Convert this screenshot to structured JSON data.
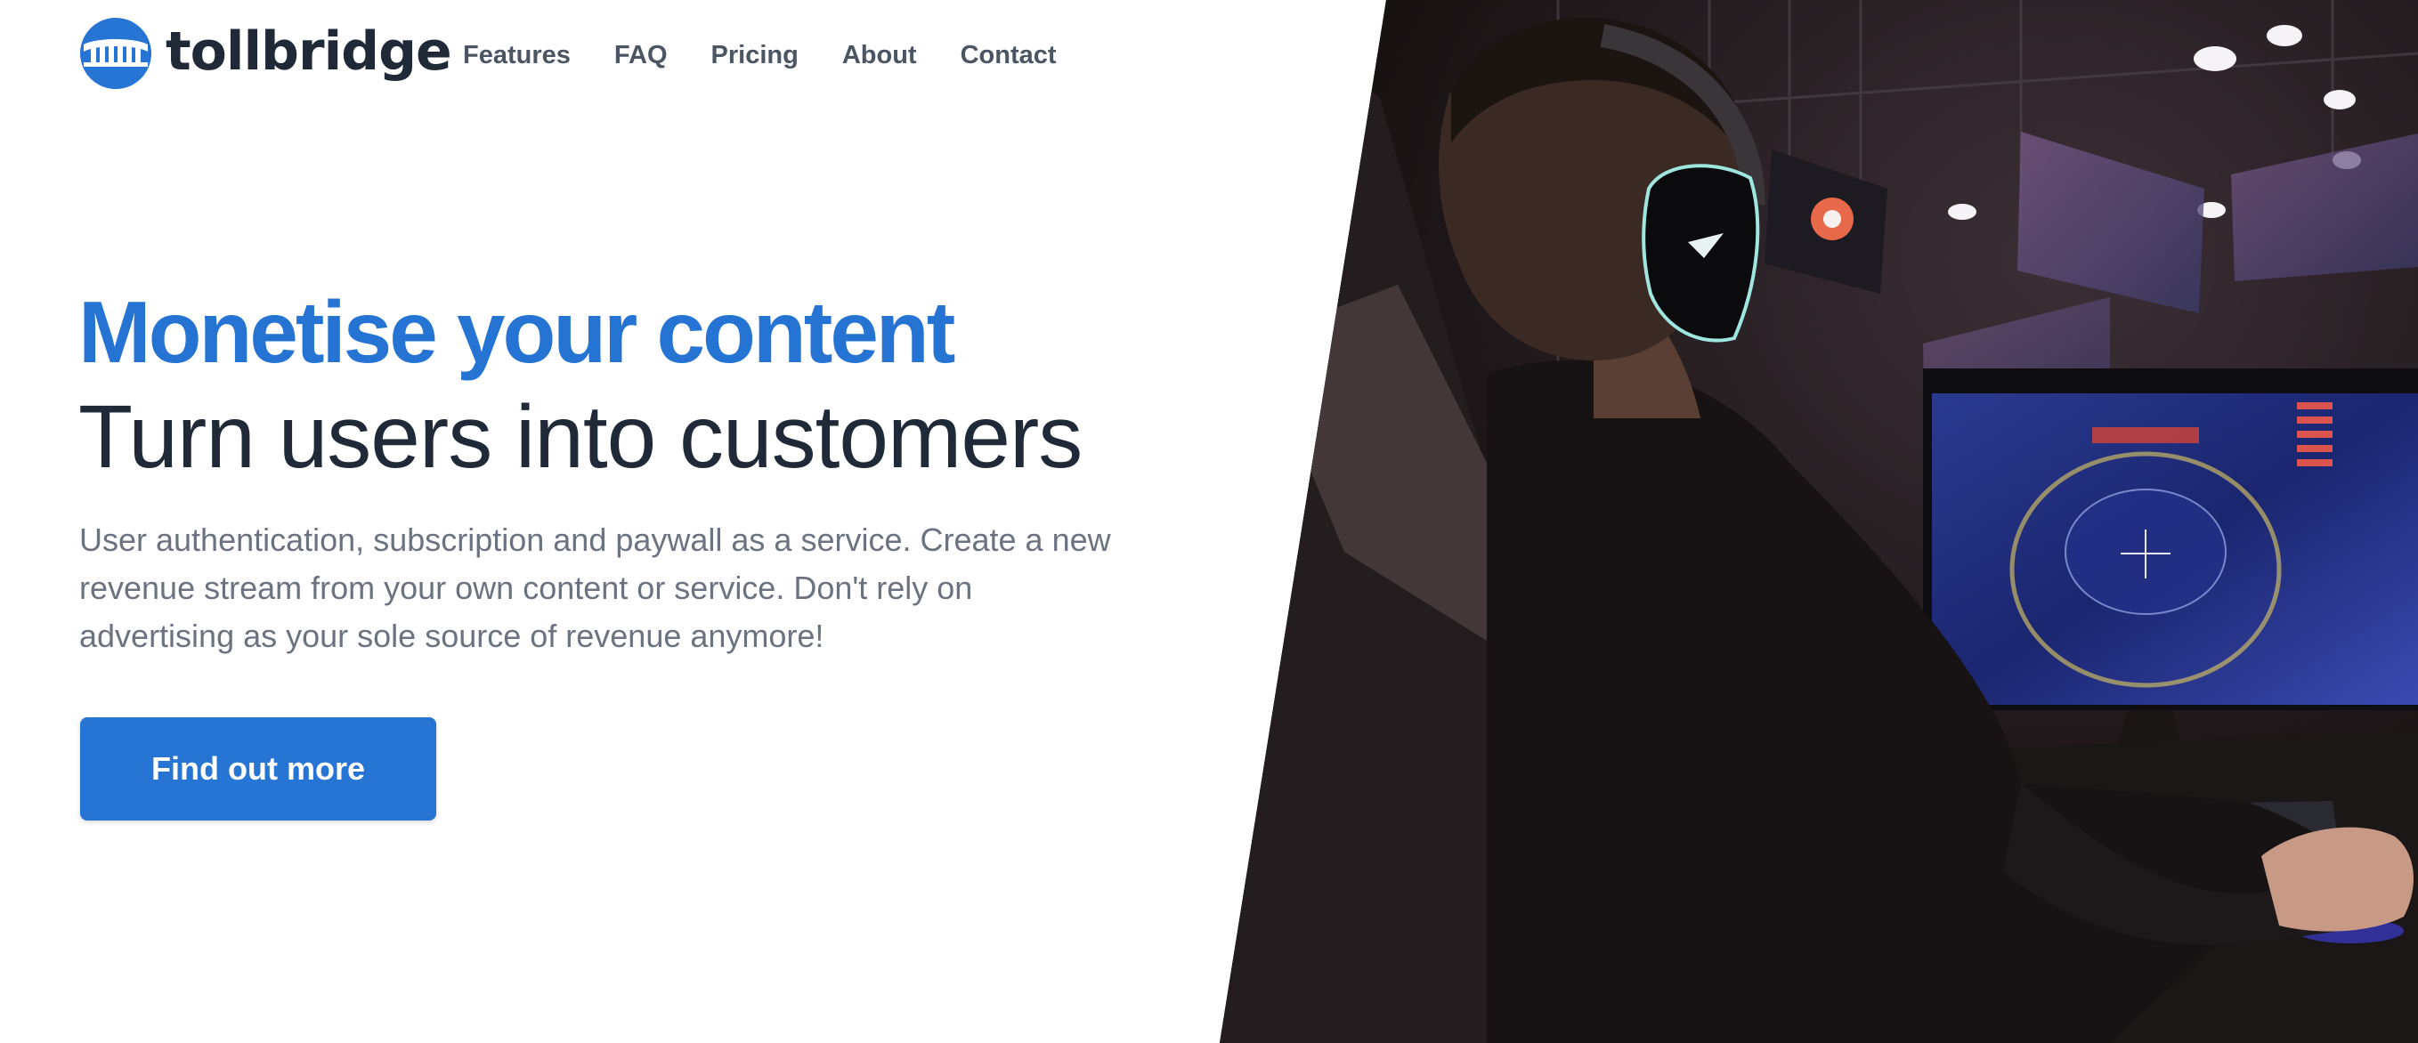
{
  "brand": {
    "name": "tollbridge",
    "logo_icon": "bridge-logo-icon",
    "primary_color": "#2674d4",
    "text_color": "#1f2937"
  },
  "nav": {
    "items": [
      {
        "label": "Features"
      },
      {
        "label": "FAQ"
      },
      {
        "label": "Pricing"
      },
      {
        "label": "About"
      },
      {
        "label": "Contact"
      }
    ]
  },
  "hero": {
    "title": "Monetise your content",
    "subtitle": "Turn users into customers",
    "description": "User authentication, subscription and paywall as a service. Create a new revenue stream from your own content or service. Don't rely on advertising as your sole source of revenue anymore!",
    "cta_label": "Find out more",
    "image_subject": "gamer-with-headset-at-esports-event-photo"
  }
}
